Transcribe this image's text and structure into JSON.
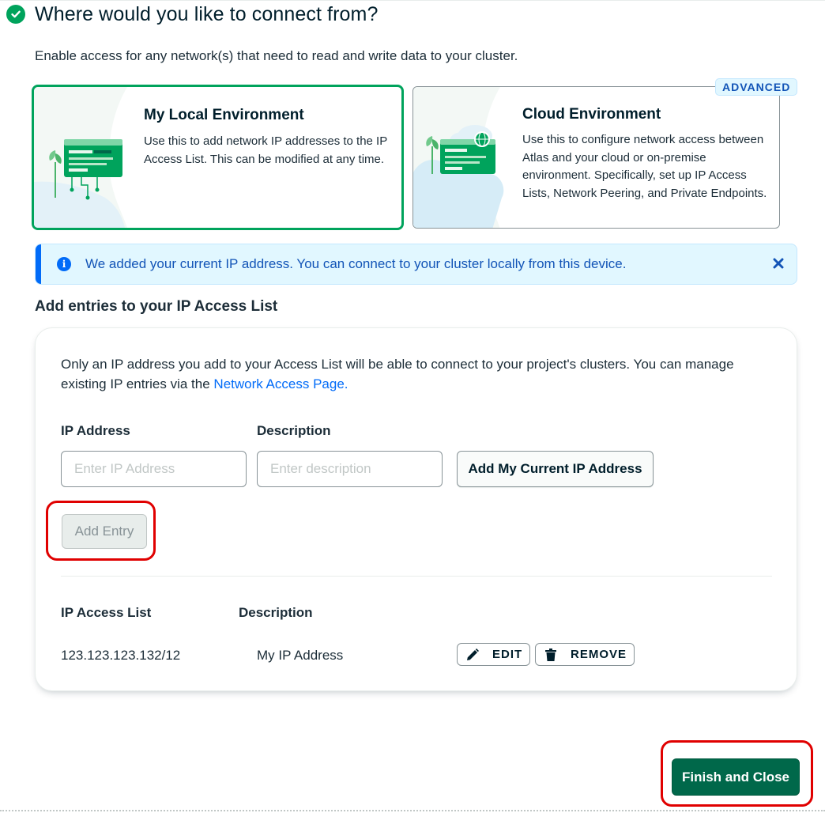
{
  "header": {
    "title": "Where would you like to connect from?"
  },
  "intro_text": "Enable access for any network(s) that need to read and write data to your cluster.",
  "environments": {
    "local": {
      "title": "My Local Environment",
      "description": "Use this to add network IP addresses to the IP Access List. This can be modified at any time.",
      "selected": true
    },
    "cloud": {
      "title": "Cloud Environment",
      "description": "Use this to configure network access between Atlas and your cloud or on-premise environment. Specifically, set up IP Access Lists, Network Peering, and Private Endpoints.",
      "badge": "ADVANCED",
      "selected": false
    }
  },
  "banner": {
    "text": "We added your current IP address. You can connect to your cluster locally from this device.",
    "icon": "info-icon",
    "close_icon": "close-icon"
  },
  "access_section": {
    "title": "Add entries to your IP Access List",
    "description": "Only an IP address you add to your Access List will be able to connect to your project's clusters. You can manage existing IP entries via the",
    "link_text": "Network Access Page.",
    "form": {
      "ip_label": "IP Address",
      "ip_placeholder": "Enter IP Address",
      "ip_value": "",
      "description_label": "Description",
      "description_placeholder": "Enter description",
      "description_value": "",
      "add_current_ip_label": "Add My Current IP Address",
      "add_entry_label": "Add Entry"
    },
    "list": {
      "headers": [
        "IP Access List",
        "Description"
      ],
      "rows": [
        {
          "ip": "123.123.123.132/12",
          "description": "My IP Address",
          "edit_label": "EDIT",
          "remove_label": "REMOVE"
        }
      ]
    }
  },
  "footer": {
    "finish_label": "Finish and Close"
  },
  "colors": {
    "primary_green": "#00684a",
    "success_green": "#00a35c",
    "info_blue": "#016bf8",
    "highlight_red": "#e00000"
  }
}
